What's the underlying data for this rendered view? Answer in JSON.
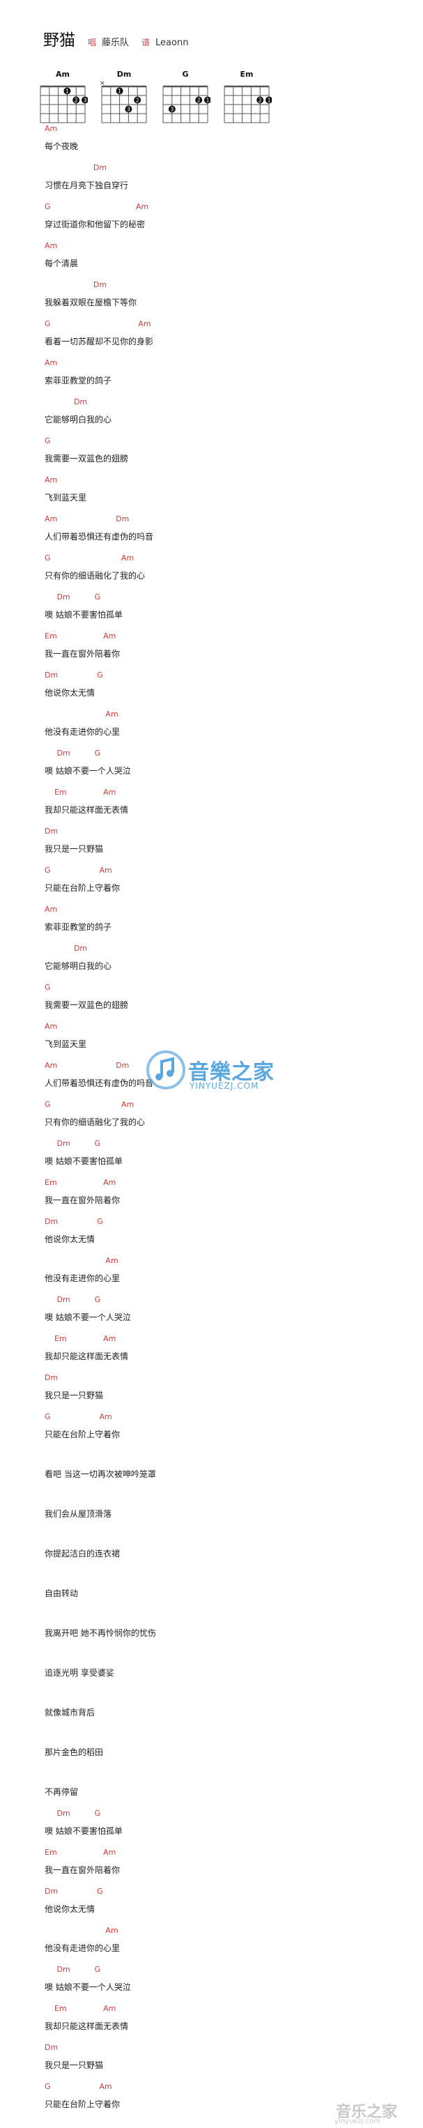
{
  "header": {
    "title": "野猫",
    "singer_label": "唱",
    "singer": "藤乐队",
    "arranger_label": "谱",
    "arranger": "Leaonn"
  },
  "chord_diagrams": [
    {
      "name": "Am",
      "muted": "",
      "dots": [
        [
          1,
          3,
          "1"
        ],
        [
          2,
          2,
          "2"
        ],
        [
          2,
          1,
          "3"
        ]
      ]
    },
    {
      "name": "Dm",
      "muted": "×",
      "dots": [
        [
          1,
          4,
          "1"
        ],
        [
          2,
          2,
          "2"
        ],
        [
          3,
          3,
          "3"
        ]
      ]
    },
    {
      "name": "G",
      "muted": "",
      "dots": [
        [
          2,
          1,
          "1"
        ],
        [
          2,
          2,
          "2"
        ],
        [
          3,
          5,
          "3"
        ]
      ]
    },
    {
      "name": "Em",
      "muted": "",
      "dots": [
        [
          2,
          1,
          "1"
        ],
        [
          2,
          2,
          "2"
        ]
      ]
    }
  ],
  "sheet": [
    {
      "t": "c",
      "text": "Am"
    },
    {
      "t": "l",
      "text": "每个夜晚"
    },
    {
      "t": "c",
      "text": "                    Dm"
    },
    {
      "t": "l",
      "text": "习惯在月亮下独自穿行"
    },
    {
      "t": "c",
      "text": "G                                   Am"
    },
    {
      "t": "l",
      "text": "穿过街道你和他留下的秘密"
    },
    {
      "t": "c",
      "text": "Am"
    },
    {
      "t": "l",
      "text": "每个清晨"
    },
    {
      "t": "c",
      "text": "                    Dm"
    },
    {
      "t": "l",
      "text": "我躲着双眼在屋檐下等你"
    },
    {
      "t": "c",
      "text": "G                                    Am"
    },
    {
      "t": "l",
      "text": "看着一切苏醒却不见你的身影"
    },
    {
      "t": "c",
      "text": "Am"
    },
    {
      "t": "l",
      "text": "索菲亚教堂的鸽子"
    },
    {
      "t": "c",
      "text": "            Dm"
    },
    {
      "t": "l",
      "text": "它能够明白我的心"
    },
    {
      "t": "c",
      "text": "G"
    },
    {
      "t": "l",
      "text": "我需要一双蓝色的翅膀"
    },
    {
      "t": "c",
      "text": "Am"
    },
    {
      "t": "l",
      "text": "飞到蓝天里"
    },
    {
      "t": "c",
      "text": "Am                        Dm"
    },
    {
      "t": "l",
      "text": "人们带着恐惧还有虚伪的吗音"
    },
    {
      "t": "c",
      "text": "G                             Am"
    },
    {
      "t": "l",
      "text": "只有你的细语融化了我的心"
    },
    {
      "t": "c",
      "text": "     Dm          G"
    },
    {
      "t": "l",
      "text": "噢 姑娘不要害怕孤单"
    },
    {
      "t": "c",
      "text": "Em                   Am"
    },
    {
      "t": "l",
      "text": "我一直在窗外陪着你"
    },
    {
      "t": "c",
      "text": "Dm                G"
    },
    {
      "t": "l",
      "text": "他说你太无情"
    },
    {
      "t": "c",
      "text": "                         Am"
    },
    {
      "t": "l",
      "text": "他没有走进你的心里"
    },
    {
      "t": "c",
      "text": "     Dm          G"
    },
    {
      "t": "l",
      "text": "噢 姑娘不要一个人哭泣"
    },
    {
      "t": "c",
      "text": "    Em               Am"
    },
    {
      "t": "l",
      "text": "我却只能这样面无表情"
    },
    {
      "t": "c",
      "text": "Dm"
    },
    {
      "t": "l",
      "text": "我只是一只野猫"
    },
    {
      "t": "c",
      "text": "G                    Am"
    },
    {
      "t": "l",
      "text": "只能在台阶上守着你"
    },
    {
      "t": "c",
      "text": "Am"
    },
    {
      "t": "l",
      "text": "索菲亚教堂的鸽子"
    },
    {
      "t": "c",
      "text": "            Dm"
    },
    {
      "t": "l",
      "text": "它能够明白我的心"
    },
    {
      "t": "c",
      "text": "G"
    },
    {
      "t": "l",
      "text": "我需要一双蓝色的翅膀"
    },
    {
      "t": "c",
      "text": "Am"
    },
    {
      "t": "l",
      "text": "飞到蓝天里"
    },
    {
      "t": "c",
      "text": "Am                        Dm"
    },
    {
      "t": "l",
      "text": "人们带着恐惧还有虚伪的吗音"
    },
    {
      "t": "c",
      "text": "G                             Am"
    },
    {
      "t": "l",
      "text": "只有你的细语融化了我的心"
    },
    {
      "t": "c",
      "text": "     Dm          G"
    },
    {
      "t": "l",
      "text": "噢 姑娘不要害怕孤单"
    },
    {
      "t": "c",
      "text": "Em                   Am"
    },
    {
      "t": "l",
      "text": "我一直在窗外陪着你"
    },
    {
      "t": "c",
      "text": "Dm                G"
    },
    {
      "t": "l",
      "text": "他说你太无情"
    },
    {
      "t": "c",
      "text": "                         Am"
    },
    {
      "t": "l",
      "text": "他没有走进你的心里"
    },
    {
      "t": "c",
      "text": "     Dm          G"
    },
    {
      "t": "l",
      "text": "噢 姑娘不要一个人哭泣"
    },
    {
      "t": "c",
      "text": "    Em               Am"
    },
    {
      "t": "l",
      "text": "我却只能这样面无表情"
    },
    {
      "t": "c",
      "text": "Dm"
    },
    {
      "t": "l",
      "text": "我只是一只野猫"
    },
    {
      "t": "c",
      "text": "G                    Am"
    },
    {
      "t": "l",
      "text": "只能在台阶上守着你"
    },
    {
      "t": "gap"
    },
    {
      "t": "l",
      "text": "看吧 当这一切再次被呻吟笼罩"
    },
    {
      "t": "gap"
    },
    {
      "t": "l",
      "text": "我们会从屋顶滑落"
    },
    {
      "t": "gap"
    },
    {
      "t": "l",
      "text": "你提起洁白的连衣裙"
    },
    {
      "t": "gap"
    },
    {
      "t": "l",
      "text": "自由转动"
    },
    {
      "t": "gap"
    },
    {
      "t": "l",
      "text": "我离开吧 她不再怜悯你的忧伤"
    },
    {
      "t": "gap"
    },
    {
      "t": "l",
      "text": "追逐光明 享受婆娑"
    },
    {
      "t": "gap"
    },
    {
      "t": "l",
      "text": "就像城市背后"
    },
    {
      "t": "gap"
    },
    {
      "t": "l",
      "text": "那片金色的稻田"
    },
    {
      "t": "gap"
    },
    {
      "t": "l",
      "text": "不再停留"
    },
    {
      "t": "c",
      "text": "     Dm          G"
    },
    {
      "t": "l",
      "text": "噢 姑娘不要害怕孤单"
    },
    {
      "t": "c",
      "text": "Em                   Am"
    },
    {
      "t": "l",
      "text": "我一直在窗外陪着你"
    },
    {
      "t": "c",
      "text": "Dm                G"
    },
    {
      "t": "l",
      "text": "他说你太无情"
    },
    {
      "t": "c",
      "text": "                         Am"
    },
    {
      "t": "l",
      "text": "他没有走进你的心里"
    },
    {
      "t": "c",
      "text": "     Dm          G"
    },
    {
      "t": "l",
      "text": "噢 姑娘不要一个人哭泣"
    },
    {
      "t": "c",
      "text": "    Em               Am"
    },
    {
      "t": "l",
      "text": "我却只能这样面无表情"
    },
    {
      "t": "c",
      "text": "Dm"
    },
    {
      "t": "l",
      "text": "我只是一只野猫"
    },
    {
      "t": "c",
      "text": "G                    Am"
    },
    {
      "t": "l",
      "text": "只能在台阶上守着你"
    }
  ],
  "watermark": {
    "brand": "音樂之家",
    "url": "YINYUEZJ.COM"
  },
  "footer_mark": {
    "brand": "音乐之家",
    "url": "yinyuezj.com"
  },
  "colors": {
    "chord": "#d23b3b",
    "lyric": "#222222",
    "watermark": "#5aa7e0"
  }
}
